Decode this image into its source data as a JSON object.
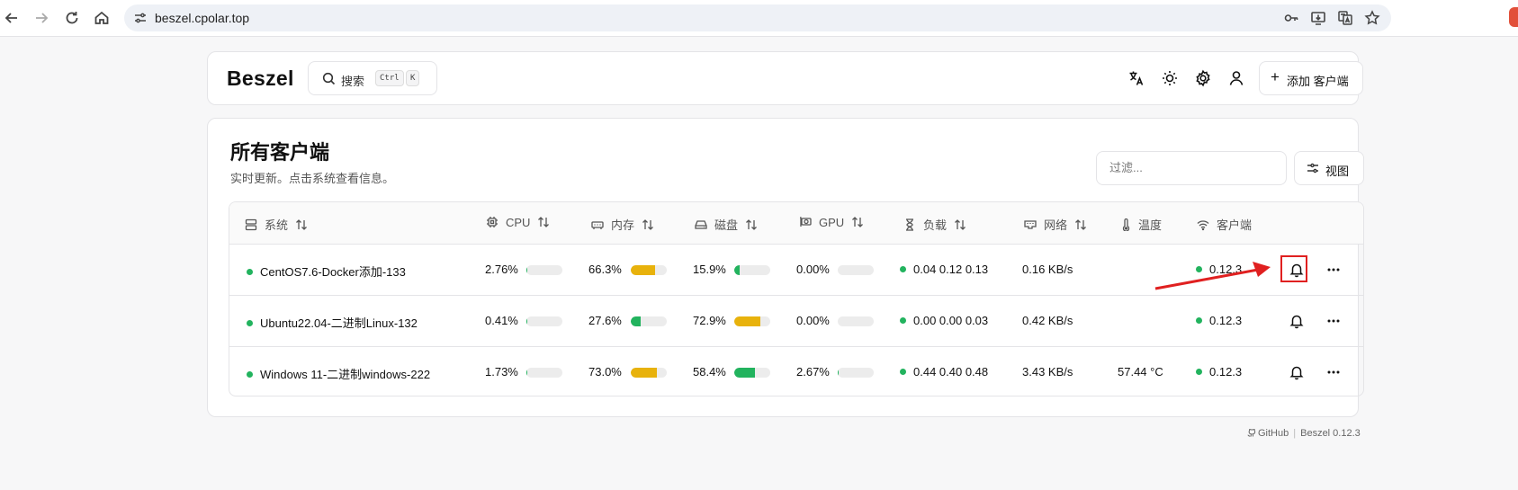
{
  "browser": {
    "url": "beszel.cpolar.top"
  },
  "header": {
    "logo": "Beszel",
    "search_label": "搜索",
    "kbd_ctrl": "Ctrl",
    "kbd_k": "K",
    "add_client_label": "添加 客户端"
  },
  "panel": {
    "title": "所有客户端",
    "subtitle": "实时更新。点击系统查看信息。",
    "filter_placeholder": "过滤...",
    "view_label": "视图"
  },
  "table": {
    "headers": {
      "system": "系统",
      "cpu": "CPU",
      "memory": "内存",
      "disk": "磁盘",
      "gpu": "GPU",
      "load": "负载",
      "network": "网络",
      "temperature": "温度",
      "agent": "客户端"
    },
    "rows": [
      {
        "name": "CentOS7.6-Docker添加-133",
        "cpu": "2.76%",
        "cpu_pct": 2.76,
        "memory": "66.3%",
        "memory_pct": 66.3,
        "disk": "15.9%",
        "disk_pct": 15.9,
        "gpu": "0.00%",
        "gpu_pct": 0,
        "load": "0.04 0.12 0.13",
        "network": "0.16 KB/s",
        "temperature": "",
        "agent": "0.12.3"
      },
      {
        "name": "Ubuntu22.04-二进制Linux-132",
        "cpu": "0.41%",
        "cpu_pct": 0.41,
        "memory": "27.6%",
        "memory_pct": 27.6,
        "disk": "72.9%",
        "disk_pct": 72.9,
        "gpu": "0.00%",
        "gpu_pct": 0,
        "load": "0.00 0.00 0.03",
        "network": "0.42 KB/s",
        "temperature": "",
        "agent": "0.12.3"
      },
      {
        "name": "Windows 11-二进制windows-222",
        "cpu": "1.73%",
        "cpu_pct": 1.73,
        "memory": "73.0%",
        "memory_pct": 73.0,
        "disk": "58.4%",
        "disk_pct": 58.4,
        "gpu": "2.67%",
        "gpu_pct": 2.67,
        "load": "0.44 0.40 0.48",
        "network": "3.43 KB/s",
        "temperature": "57.44 °C",
        "agent": "0.12.3"
      }
    ]
  },
  "colors": {
    "status_up": "#22b35e",
    "bar_warn": "#e8b20c",
    "bar_ok": "#22b35e",
    "bar_track": "#ececec",
    "annotation": "#e02020"
  },
  "footer": {
    "github": "GitHub",
    "version": "Beszel 0.12.3"
  }
}
